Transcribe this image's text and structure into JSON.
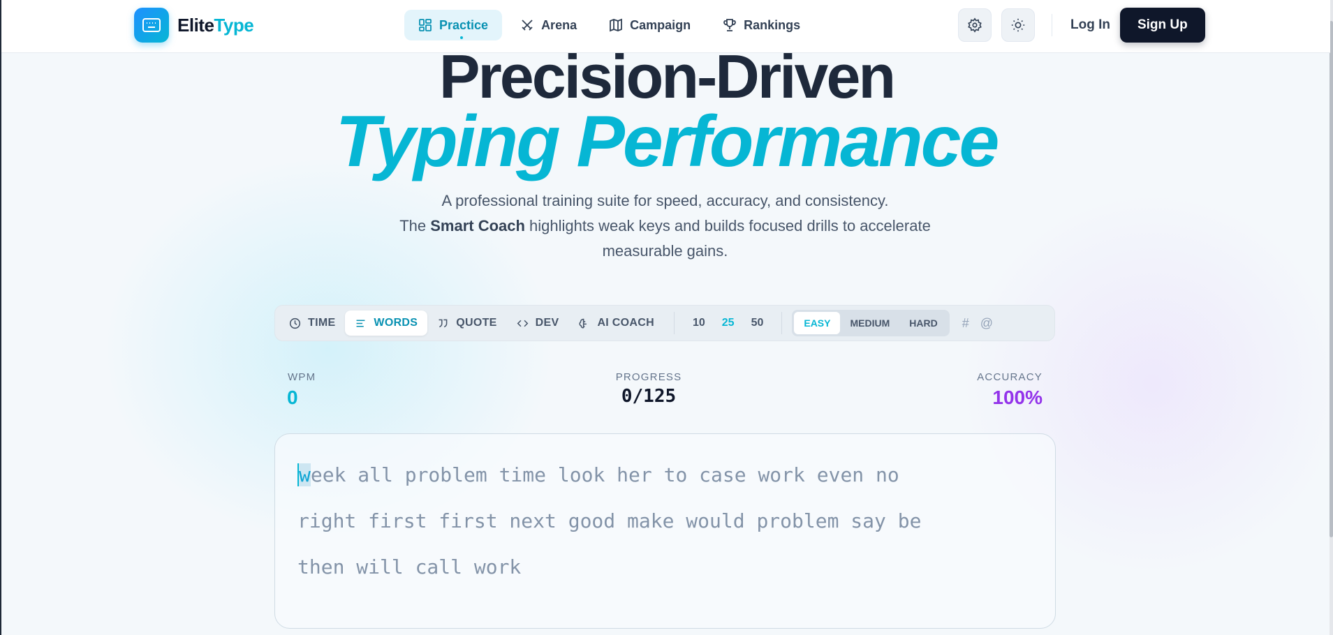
{
  "brand": {
    "name_part1": "Elite",
    "name_part2": "Type"
  },
  "nav": {
    "items": [
      {
        "label": "Practice",
        "icon": "grid-icon",
        "active": true
      },
      {
        "label": "Arena",
        "icon": "swords-icon",
        "active": false
      },
      {
        "label": "Campaign",
        "icon": "map-icon",
        "active": false
      },
      {
        "label": "Rankings",
        "icon": "trophy-icon",
        "active": false
      }
    ],
    "login_label": "Log In",
    "signup_label": "Sign Up"
  },
  "hero": {
    "line1": "Precision-Driven",
    "line2": "Typing Performance",
    "sub_line1": "A professional training suite for speed, accuracy, and consistency.",
    "sub_line2_pre": "The ",
    "sub_line2_bold": "Smart Coach",
    "sub_line2_post": " highlights weak keys and builds focused drills to accelerate measurable gains."
  },
  "toolbar": {
    "modes": [
      {
        "label": "TIME",
        "icon": "clock-icon",
        "active": false
      },
      {
        "label": "WORDS",
        "icon": "lines-icon",
        "active": true
      },
      {
        "label": "QUOTE",
        "icon": "quote-icon",
        "active": false
      },
      {
        "label": "DEV",
        "icon": "code-icon",
        "active": false
      },
      {
        "label": "AI COACH",
        "icon": "brain-icon",
        "active": false
      }
    ],
    "counts": [
      "10",
      "25",
      "50"
    ],
    "active_count": "25",
    "difficulties": [
      "EASY",
      "MEDIUM",
      "HARD"
    ],
    "active_difficulty": "EASY",
    "symbols": [
      "#",
      "@"
    ]
  },
  "stats": {
    "wpm_label": "WPM",
    "wpm_value": "0",
    "progress_label": "PROGRESS",
    "progress_value": "0/125",
    "accuracy_label": "ACCURACY",
    "accuracy_value": "100%"
  },
  "typing": {
    "first_char": "w",
    "rest_line1": "eek all problem time look her to case work even no",
    "line2": "right first first next good make would problem say be",
    "line3": "then will call work"
  },
  "colors": {
    "accent": "#06b6d4",
    "accuracy": "#9333ea",
    "dark": "#0f172a"
  }
}
